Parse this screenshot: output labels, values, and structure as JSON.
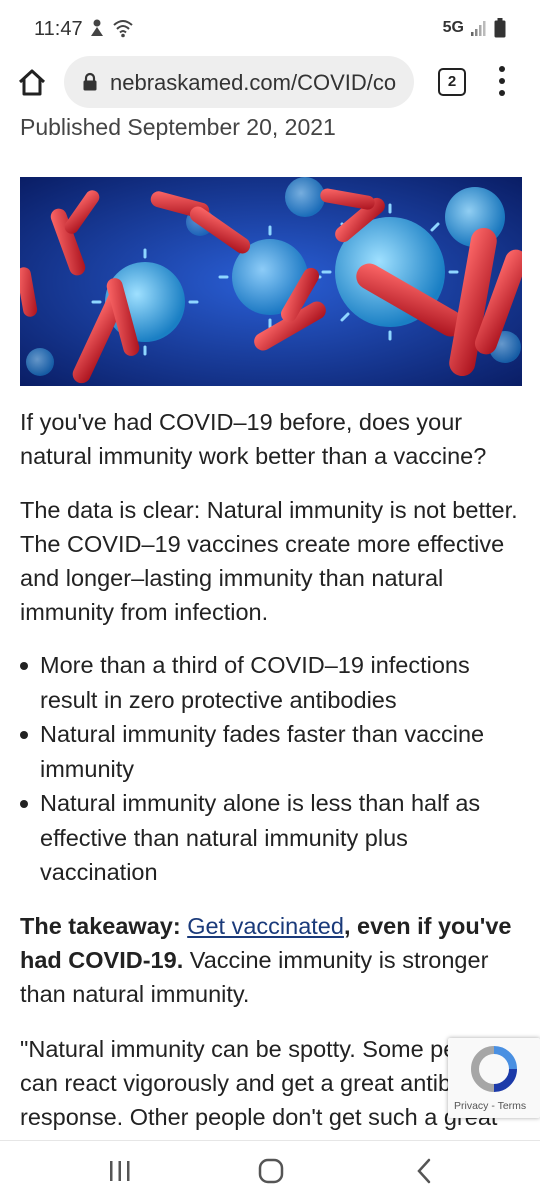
{
  "status_bar": {
    "time": "11:47",
    "network": "5G",
    "icons": [
      "notification-icon",
      "wifi-icon",
      "signal-icon",
      "battery-icon"
    ]
  },
  "browser": {
    "url": "nebraskamed.com/COVID/co",
    "tab_count": "2"
  },
  "article": {
    "published": "Published September 20, 2021",
    "intro": "If you've had COVID–19 before, does your natural immunity work better than a vaccine?",
    "summary": "The data is clear: Natural immunity is not better. The COVID–19 vaccines create more effective and longer–lasting immunity than natural immunity from infection.",
    "bullets": [
      "More than a third of COVID–19 infections result in zero protective antibodies",
      "Natural immunity fades faster than vaccine immunity",
      "Natural immunity alone is less than half as effective than natural immunity plus vaccination"
    ],
    "takeaway_label": "The takeaway:",
    "takeaway_link": "Get vaccinated",
    "takeaway_bold": ", even if you've had COVID-19.",
    "takeaway_rest": " Vaccine immunity is stronger than natural immunity.",
    "quote": "\"Natural immunity can be spotty. Some people can react vigorously and get a great antibody response. Other people don't get such a great"
  },
  "recaptcha": {
    "privacy": "Privacy",
    "separator": " - ",
    "terms": "Terms"
  },
  "colors": {
    "link": "#1a3a7a",
    "hero_bg": "#0e2a86",
    "virus": "#3fa9e6",
    "antibody": "#d42a35"
  }
}
